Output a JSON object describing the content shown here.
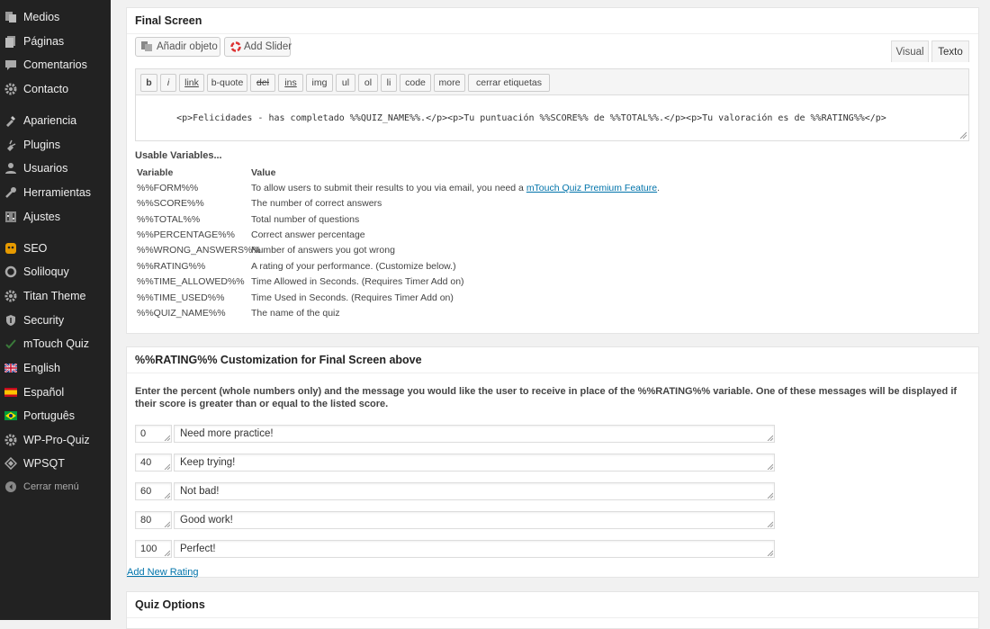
{
  "sidebar": {
    "items": [
      {
        "label": "Medios",
        "icon": "media-icon"
      },
      {
        "label": "Páginas",
        "icon": "pages-icon"
      },
      {
        "label": "Comentarios",
        "icon": "comments-icon"
      },
      {
        "label": "Contacto",
        "icon": "gear-icon"
      },
      {
        "label": "Apariencia",
        "icon": "appearance-icon"
      },
      {
        "label": "Plugins",
        "icon": "plugins-icon"
      },
      {
        "label": "Usuarios",
        "icon": "users-icon"
      },
      {
        "label": "Herramientas",
        "icon": "tools-icon"
      },
      {
        "label": "Ajustes",
        "icon": "settings-icon"
      },
      {
        "label": "SEO",
        "icon": "seo-icon"
      },
      {
        "label": "Soliloquy",
        "icon": "soliloquy-icon"
      },
      {
        "label": "Titan Theme",
        "icon": "gear-icon"
      },
      {
        "label": "Security",
        "icon": "shield-icon"
      },
      {
        "label": "mTouch Quiz",
        "icon": "check-icon"
      },
      {
        "label": "English",
        "icon": "uk-flag-icon"
      },
      {
        "label": "Español",
        "icon": "spain-flag-icon"
      },
      {
        "label": "Português",
        "icon": "brazil-flag-icon"
      },
      {
        "label": "WP-Pro-Quiz",
        "icon": "gear-icon"
      },
      {
        "label": "WPSQT",
        "icon": "diamond-icon"
      },
      {
        "label": "Cerrar menú",
        "icon": "collapse-icon"
      }
    ]
  },
  "final_screen": {
    "title": "Final Screen",
    "add_object": "Añadir objeto",
    "add_slider": "Add Slider",
    "tab_visual": "Visual",
    "tab_text": "Texto",
    "quicktags": [
      "b",
      "i",
      "link",
      "b-quote",
      "del",
      "ins",
      "img",
      "ul",
      "ol",
      "li",
      "code",
      "more",
      "cerrar etiquetas"
    ],
    "editor_content": "<p>Felicidades - has completado %%QUIZ_NAME%%.</p><p>Tu puntuación %%SCORE%% de %%TOTAL%%.</p><p>Tu valoración es de %%RATING%%</p>",
    "usable_title": "Usable Variables...",
    "var_header": {
      "variable": "Variable",
      "value": "Value"
    },
    "variables": [
      {
        "name": "%%FORM%%",
        "desc": "To allow users to submit their results to you via email, you need a ",
        "link": "mTouch Quiz Premium Feature",
        "after": "."
      },
      {
        "name": "%%SCORE%%",
        "desc": "The number of correct answers"
      },
      {
        "name": "%%TOTAL%%",
        "desc": "Total number of questions"
      },
      {
        "name": "%%PERCENTAGE%%",
        "desc": "Correct answer percentage"
      },
      {
        "name": "%%WRONG_ANSWERS%%",
        "desc": "Number of answers you got wrong"
      },
      {
        "name": "%%RATING%%",
        "desc": "A rating of your performance. (Customize below.)"
      },
      {
        "name": "%%TIME_ALLOWED%%",
        "desc": "Time Allowed in Seconds. (Requires Timer Add on)"
      },
      {
        "name": "%%TIME_USED%%",
        "desc": "Time Used in Seconds. (Requires Timer Add on)"
      },
      {
        "name": "%%QUIZ_NAME%%",
        "desc": "The name of the quiz"
      }
    ]
  },
  "rating": {
    "title": "%%RATING%% Customization for Final Screen above",
    "description": "Enter the percent (whole numbers only) and the message you would like the user to receive in place of the %%RATING%% variable. One of these messages will be displayed if their score is greater than or equal to the listed score.",
    "rows": [
      {
        "percent": "0",
        "message": "Need more practice!"
      },
      {
        "percent": "40",
        "message": "Keep trying!"
      },
      {
        "percent": "60",
        "message": "Not bad!"
      },
      {
        "percent": "80",
        "message": "Good work!"
      },
      {
        "percent": "100",
        "message": "Perfect!"
      }
    ],
    "add_new": "Add New Rating"
  },
  "quiz_options": {
    "title": "Quiz Options"
  },
  "colors": {
    "sidebar_bg": "#222222",
    "link": "#0073aa",
    "page_bg": "#f1f1f1"
  }
}
